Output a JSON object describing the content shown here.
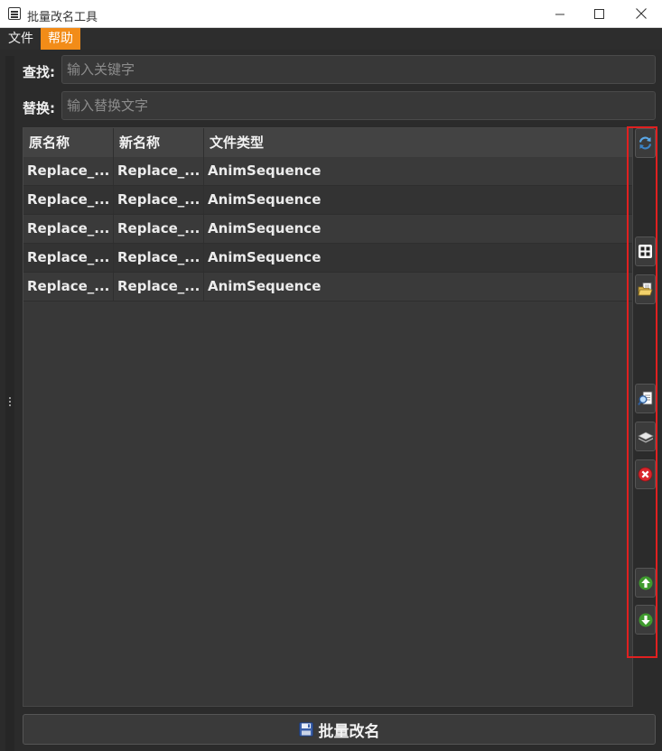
{
  "window": {
    "title": "批量改名工具",
    "minimize_icon": "minimize-icon",
    "maximize_icon": "maximize-icon",
    "close_icon": "close-icon"
  },
  "menubar": {
    "items": [
      {
        "label": "文件",
        "active": false
      },
      {
        "label": "帮助",
        "active": true
      }
    ]
  },
  "search": {
    "find_label": "查找:",
    "find_value": "",
    "find_placeholder": "输入关键字",
    "replace_label": "替换:",
    "replace_value": "",
    "replace_placeholder": "输入替换文字"
  },
  "table": {
    "headers": [
      "原名称",
      "新名称",
      "文件类型"
    ],
    "rows": [
      [
        "Replace_...",
        "Replace_...",
        "AnimSequence"
      ],
      [
        "Replace_...",
        "Replace_...",
        "AnimSequence"
      ],
      [
        "Replace_...",
        "Replace_...",
        "AnimSequence"
      ],
      [
        "Replace_...",
        "Replace_...",
        "AnimSequence"
      ],
      [
        "Replace_...",
        "Replace_...",
        "AnimSequence"
      ]
    ]
  },
  "toolbar": {
    "buttons": [
      {
        "name": "refresh-button",
        "icon": "refresh-icon"
      },
      {
        "name": "select-all-button",
        "icon": "grid-icon"
      },
      {
        "name": "open-folder-button",
        "icon": "folder-icon"
      },
      {
        "name": "find-asset-button",
        "icon": "document-search-icon"
      },
      {
        "name": "layers-button",
        "icon": "layers-icon"
      },
      {
        "name": "remove-button",
        "icon": "remove-icon"
      },
      {
        "name": "move-up-button",
        "icon": "arrow-up-icon"
      },
      {
        "name": "move-down-button",
        "icon": "arrow-down-icon"
      }
    ]
  },
  "footer": {
    "rename_label": "批量改名",
    "rename_icon": "save-icon"
  },
  "colors": {
    "accent": "#f28c18",
    "highlight_border": "#e02020",
    "background": "#2b2b2b"
  }
}
